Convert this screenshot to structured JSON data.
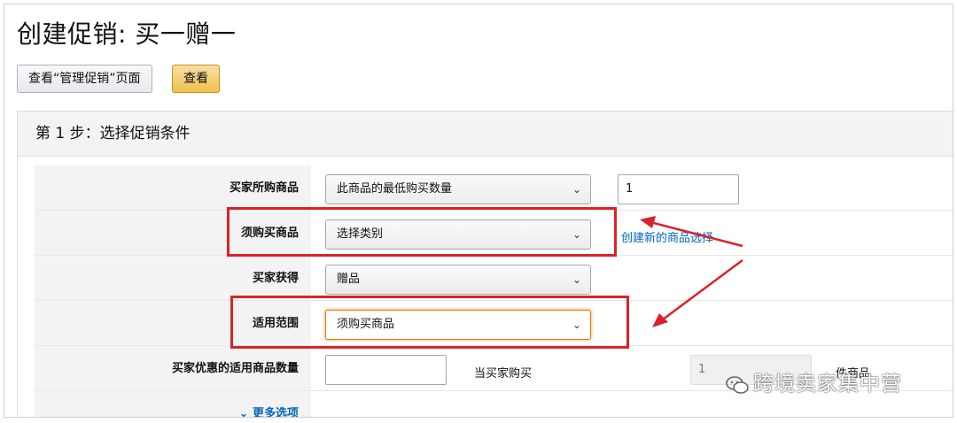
{
  "page": {
    "title": "创建促销: 买一赠一"
  },
  "toolbar": {
    "manage_label": "查看“管理促销”页面",
    "view_label": "查看"
  },
  "step": {
    "header": "第 1 步：选择促销条件"
  },
  "rows": [
    {
      "label": "买家所购商品",
      "select": "此商品的最低购买数量",
      "input_value": "1"
    },
    {
      "label": "须购买商品",
      "select": "选择类别",
      "link": "创建新的商品选择"
    },
    {
      "label": "买家获得",
      "select": "赠品"
    },
    {
      "label": "适用范围",
      "select": "须购买商品"
    },
    {
      "label": "买家优惠的适用商品数量",
      "text": "当买家购买",
      "input_value": "1",
      "suffix": "件商品"
    }
  ],
  "more": {
    "label": "更多选项"
  },
  "watermark": {
    "text": "跨境卖家集中营"
  },
  "colors": {
    "annotation": "#d9232a",
    "link": "#0066c0",
    "primary_button": "#f0c14b"
  }
}
